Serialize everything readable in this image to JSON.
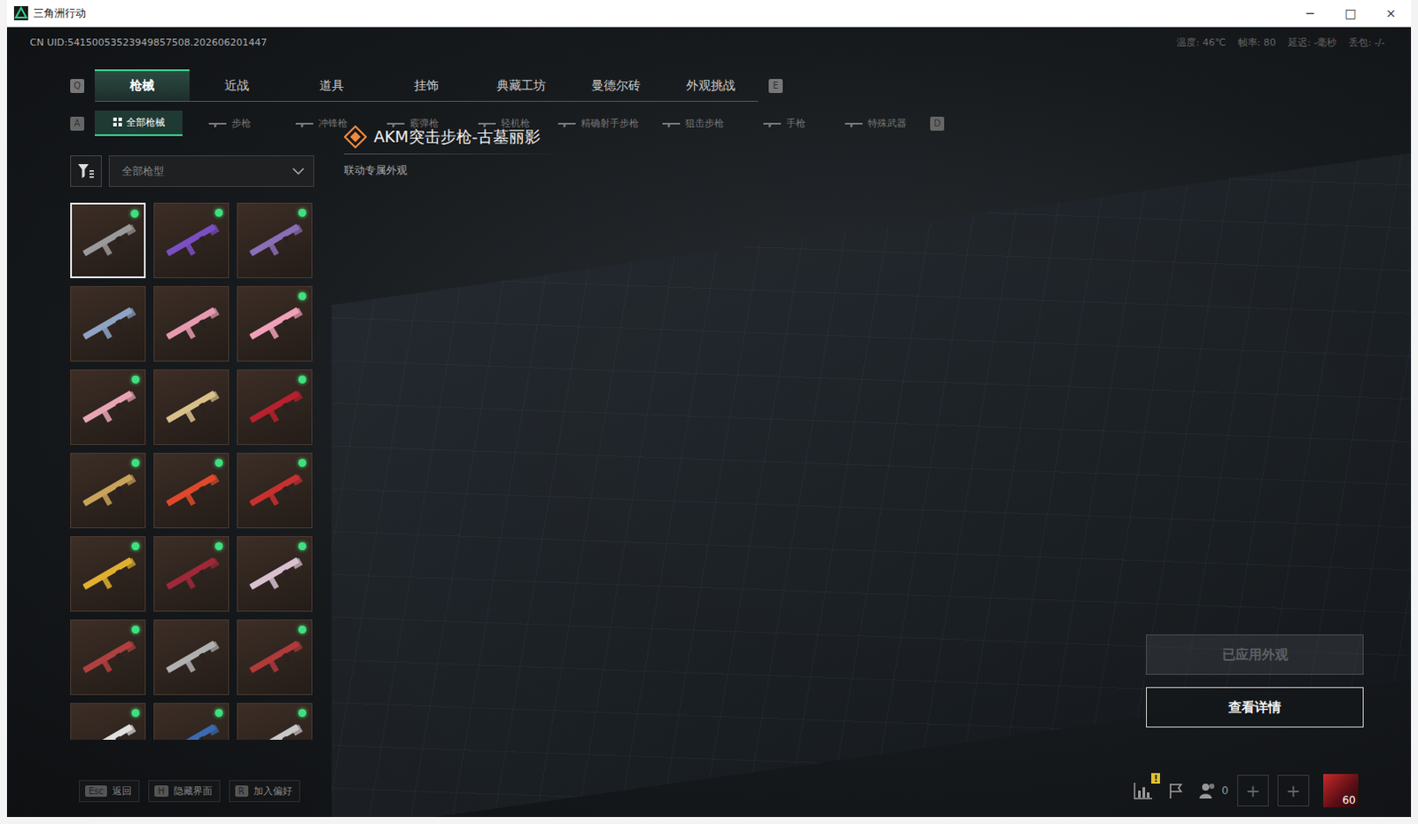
{
  "window": {
    "title": "三角洲行动",
    "controls": [
      "─",
      "□",
      "×"
    ]
  },
  "uid": "CN UID:54150053523949857508.202606201447",
  "stats": [
    "温度: 46℃",
    "帧率: 80",
    "延迟: -毫秒",
    "丢包: -/-"
  ],
  "main_tabs": {
    "prev_key": "Q",
    "next_key": "E",
    "items": [
      {
        "label": "枪械",
        "selected": true
      },
      {
        "label": "近战",
        "selected": false
      },
      {
        "label": "道具",
        "selected": false
      },
      {
        "label": "挂饰",
        "selected": false
      },
      {
        "label": "典藏工坊",
        "selected": false
      },
      {
        "label": "曼德尔砖",
        "selected": false
      },
      {
        "label": "外观挑战",
        "selected": false
      }
    ]
  },
  "sub_tabs": {
    "prev_key": "A",
    "next_key": "D",
    "items": [
      {
        "label": "全部枪械",
        "selected": true
      },
      {
        "label": "步枪",
        "selected": false
      },
      {
        "label": "冲锋枪",
        "selected": false
      },
      {
        "label": "霰弹枪",
        "selected": false
      },
      {
        "label": "轻机枪",
        "selected": false
      },
      {
        "label": "精确射手步枪",
        "selected": false
      },
      {
        "label": "狙击步枪",
        "selected": false
      },
      {
        "label": "手枪",
        "selected": false
      },
      {
        "label": "特殊武器",
        "selected": false
      }
    ]
  },
  "filter": {
    "value": "全部枪型"
  },
  "skins": [
    {
      "selected": true,
      "equipped": true,
      "color": "#9a9a9a"
    },
    {
      "selected": false,
      "equipped": true,
      "color": "#7b4fc4"
    },
    {
      "selected": false,
      "equipped": true,
      "color": "#8a6fb8"
    },
    {
      "selected": false,
      "equipped": false,
      "color": "#8fa3c4"
    },
    {
      "selected": false,
      "equipped": false,
      "color": "#e59ab0"
    },
    {
      "selected": false,
      "equipped": true,
      "color": "#f0a0b8"
    },
    {
      "selected": false,
      "equipped": true,
      "color": "#e8a4b4"
    },
    {
      "selected": false,
      "equipped": false,
      "color": "#d9c08a"
    },
    {
      "selected": false,
      "equipped": true,
      "color": "#b8202e"
    },
    {
      "selected": false,
      "equipped": true,
      "color": "#c9a35a"
    },
    {
      "selected": false,
      "equipped": true,
      "color": "#e0482c"
    },
    {
      "selected": false,
      "equipped": true,
      "color": "#c83030"
    },
    {
      "selected": false,
      "equipped": true,
      "color": "#e0b030"
    },
    {
      "selected": false,
      "equipped": true,
      "color": "#a02838"
    },
    {
      "selected": false,
      "equipped": true,
      "color": "#d8c0d0"
    },
    {
      "selected": false,
      "equipped": true,
      "color": "#b04040"
    },
    {
      "selected": false,
      "equipped": false,
      "color": "#b0b0b0"
    },
    {
      "selected": false,
      "equipped": true,
      "color": "#b03a3a"
    },
    {
      "selected": false,
      "equipped": true,
      "color": "#e0e0e0"
    },
    {
      "selected": false,
      "equipped": true,
      "color": "#3a6ab0"
    },
    {
      "selected": false,
      "equipped": true,
      "color": "#c8c8c8"
    }
  ],
  "detail": {
    "title": "AKM突击步枪-古墓丽影",
    "subtitle": "联动专属外观"
  },
  "actions": [
    {
      "label": "已应用外观",
      "disabled": true
    },
    {
      "label": "查看详情",
      "disabled": false
    }
  ],
  "hints": [
    {
      "key": "Esc",
      "label": "返回"
    },
    {
      "key": "H",
      "label": "隐藏界面"
    },
    {
      "key": "R",
      "label": "加入偏好"
    }
  ],
  "social": {
    "alert": "!",
    "friends": "0",
    "slots": [
      "+",
      "+"
    ],
    "level": "60"
  }
}
